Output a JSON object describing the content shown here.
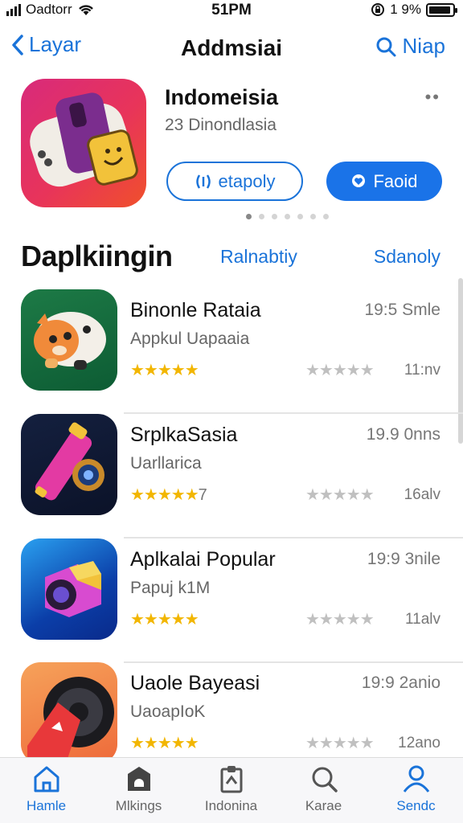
{
  "status_bar": {
    "carrier": "Oadtorr",
    "time": "51PM",
    "battery": "1 9%"
  },
  "nav": {
    "back_label": "Layar",
    "title": "Addmsiai",
    "search_label": "Niap"
  },
  "featured": {
    "name": "Indomeisia",
    "subtitle": "23 Dinondlasia",
    "more": "••",
    "button_outline": "etapoly",
    "button_solid": "Faoid",
    "page_dots": 7,
    "active_dot": 0
  },
  "section": {
    "title": "Daplkiingin",
    "tab1": "Ralnabtiy",
    "tab2": "Sdanoly"
  },
  "apps": [
    {
      "name": "Binonle Rataia",
      "subtitle": "Appkul Uapaaia",
      "meta": "19:5 Smle",
      "count": "11:nv",
      "stars": "★★★★★",
      "stars_suffix": "",
      "gray_stars": "★★★★★"
    },
    {
      "name": "SrplkaSasia",
      "subtitle": "Uarllarica",
      "meta": "19.9 0nns",
      "count": "16alv",
      "stars": "★★★★★",
      "stars_suffix": "7",
      "gray_stars": "★★★★★"
    },
    {
      "name": "Aplkalai Popular",
      "subtitle": "Papuj k1M",
      "meta": "19:9 3nile",
      "count": "11alv",
      "stars": "★★★★★",
      "stars_suffix": "",
      "gray_stars": "★★★★★"
    },
    {
      "name": "Uaole Bayeasi",
      "subtitle": "UaoapIoK",
      "meta": "19:9 2anio",
      "count": "12ano",
      "stars": "★★★★★",
      "stars_suffix": "",
      "gray_stars": "★★★★★"
    }
  ],
  "tabs": [
    {
      "label": "Hamle",
      "icon": "home-icon",
      "active": true
    },
    {
      "label": "Mlkings",
      "icon": "store-icon",
      "active": false
    },
    {
      "label": "Indonina",
      "icon": "clipboard-icon",
      "active": false
    },
    {
      "label": "Karae",
      "icon": "search-icon",
      "active": false
    },
    {
      "label": "Sendc",
      "icon": "profile-icon",
      "active": false
    }
  ],
  "colors": {
    "accent": "#1a73d9",
    "star": "#f2b600",
    "tab_bar": "#f7f7f9"
  }
}
